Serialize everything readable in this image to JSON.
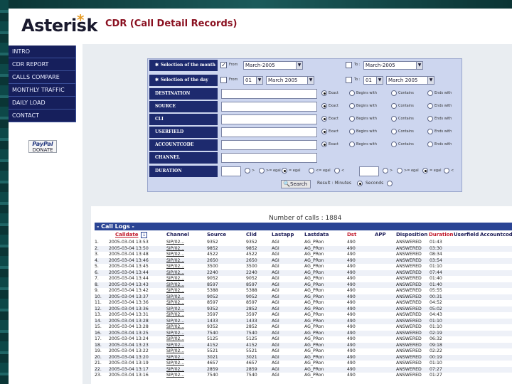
{
  "header": {
    "logo": "Asterisk",
    "logo_star": "*",
    "title": "CDR (Call Detail Records)"
  },
  "sidebar": {
    "items": [
      "INTRO",
      "CDR REPORT",
      "CALLS COMPARE",
      "MONTHLY TRAFFIC",
      "DAILY LOAD",
      "CONTACT"
    ],
    "paypal": {
      "brand": "PayPal",
      "label": "DONATE"
    }
  },
  "form": {
    "month_label": "Selection of the month",
    "day_label": "Selection of the day",
    "from_label": "From",
    "to_label": "To :",
    "from_month": "March-2005",
    "to_month": "March-2005",
    "from_day": "01",
    "to_day": "01",
    "from_day_month": "March 2005",
    "to_day_month": "March 2005",
    "fields": [
      "DESTINATION",
      "SOURCE",
      "CLI",
      "USERFIELD",
      "ACCOUNTCODE",
      "CHANNEL",
      "DURATION"
    ],
    "match_options": [
      "Exact",
      "Begins with",
      "Contains",
      "Ends with"
    ],
    "duration_ops": [
      ">",
      ">= egal",
      "= egal",
      "<= egal",
      "<"
    ],
    "search_label": "Search",
    "result_label": "Result : Minutes",
    "seconds_label": "Seconds"
  },
  "logs": {
    "number_of_calls": "Number of calls : 1884",
    "title": "- Call Logs -",
    "columns": [
      "Calldate",
      "Channel",
      "Source",
      "Clid",
      "Lastapp",
      "Lastdata",
      "Dst",
      "APP",
      "Disposition",
      "Duration",
      "Userfield",
      "Accountcode"
    ],
    "rows": [
      [
        "1.",
        "2005-03-04 13:53",
        "SIP/02...",
        "9352",
        "9352",
        "AGI",
        "AG_PRon",
        "490",
        "ANSWERED",
        "01:43"
      ],
      [
        "2.",
        "2005-03-04 13:50",
        "SIP/02...",
        "9852",
        "9852",
        "AGI",
        "AG_PRon",
        "490",
        "ANSWERED",
        "03:30"
      ],
      [
        "3.",
        "2005-03-04 13:48",
        "SIP/02...",
        "4522",
        "4522",
        "AGI",
        "AG_PRon",
        "490",
        "ANSWERED",
        "08:34"
      ],
      [
        "4.",
        "2005-03-04 13:46",
        "SIP/02...",
        "2650",
        "2650",
        "AGI",
        "AG_PRon",
        "490",
        "ANSWERED",
        "03:54"
      ],
      [
        "5.",
        "2005-03-04 13:45",
        "SIP/02...",
        "3500",
        "3500",
        "AGI",
        "AG_PRon",
        "490",
        "ANSWERED",
        "01:10"
      ],
      [
        "6.",
        "2005-03-04 13:44",
        "SIP/02...",
        "2240",
        "2240",
        "AGI",
        "AG_PRon",
        "490",
        "ANSWERED",
        "07:44"
      ],
      [
        "7.",
        "2005-03-04 13:44",
        "SIP/02...",
        "9052",
        "9052",
        "AGI",
        "AG_PRon",
        "490",
        "ANSWERED",
        "01:40"
      ],
      [
        "8.",
        "2005-03-04 13:43",
        "SIP/02...",
        "8597",
        "8597",
        "AGI",
        "AG_PRon",
        "490",
        "ANSWERED",
        "01:40"
      ],
      [
        "9.",
        "2005-03-04 13:42",
        "SIP/02...",
        "5388",
        "5388",
        "AGI",
        "AG_PRon",
        "490",
        "ANSWERED",
        "05:55"
      ],
      [
        "10.",
        "2005-03-04 13:37",
        "SIP/02...",
        "9052",
        "9052",
        "AGI",
        "AG_PRon",
        "490",
        "ANSWERED",
        "00:31"
      ],
      [
        "11.",
        "2005-03-04 13:36",
        "SIP/02...",
        "8597",
        "8597",
        "AGI",
        "AG_PRon",
        "490",
        "ANSWERED",
        "04:52"
      ],
      [
        "12.",
        "2005-03-04 13:36",
        "SIP/02...",
        "9352",
        "2852",
        "AGI",
        "AG_PRon",
        "490",
        "ANSWERED",
        "05:02"
      ],
      [
        "13.",
        "2005-03-04 13:31",
        "SIP/02...",
        "3597",
        "3597",
        "AGI",
        "AG_PRon",
        "490",
        "ANSWERED",
        "04:43"
      ],
      [
        "14.",
        "2005-03-04 13:28",
        "SIP/02...",
        "1433",
        "1433",
        "AGI",
        "AG_PRon",
        "490",
        "ANSWERED",
        "01:10"
      ],
      [
        "15.",
        "2005-03-04 13:28",
        "SIP/02...",
        "9352",
        "2852",
        "AGI",
        "AG_PRon",
        "490",
        "ANSWERED",
        "01:10"
      ],
      [
        "16.",
        "2005-03-04 13:25",
        "SIP/02...",
        "7540",
        "7540",
        "AGI",
        "AG_PRon",
        "490",
        "ANSWERED",
        "02:19"
      ],
      [
        "17.",
        "2005-03-04 13:24",
        "SIP/02...",
        "5125",
        "5125",
        "AGI",
        "AG_PRon",
        "490",
        "ANSWERED",
        "06:32"
      ],
      [
        "18.",
        "2005-03-04 13:23",
        "SIP/02...",
        "4152",
        "4152",
        "AGI",
        "AG_PRon",
        "490",
        "ANSWERED",
        "09:18"
      ],
      [
        "19.",
        "2005-03-04 13:22",
        "SIP/02...",
        "5521",
        "5521",
        "AGI",
        "AG_PRon",
        "490",
        "ANSWERED",
        "02:22"
      ],
      [
        "20.",
        "2005-03-04 13:20",
        "SIP/02...",
        "3021",
        "3021",
        "AGI",
        "AG_PRon",
        "490",
        "ANSWERED",
        "00:19"
      ],
      [
        "21.",
        "2005-03-04 13:19",
        "SIP/02...",
        "4657",
        "4657",
        "AGI",
        "AG_PRon",
        "490",
        "ANSWERED",
        "01:10"
      ],
      [
        "22.",
        "2005-03-04 13:17",
        "SIP/02...",
        "2859",
        "2859",
        "AGI",
        "AG_PRon",
        "490",
        "ANSWERED",
        "07:27"
      ],
      [
        "23.",
        "2005-03-04 13:16",
        "SIP/02...",
        "7540",
        "7540",
        "AGI",
        "AG_PRon",
        "490",
        "ANSWERED",
        "01:27"
      ]
    ]
  }
}
